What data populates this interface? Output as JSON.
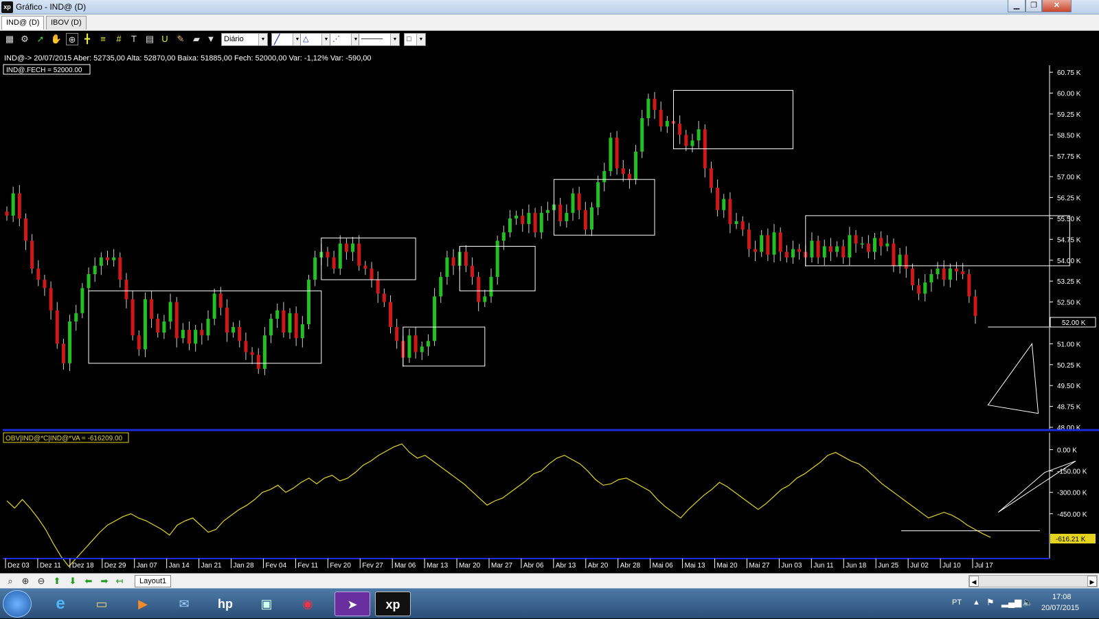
{
  "window": {
    "title": "Gráfico - IND@ (D)",
    "app_icon": "xp",
    "controls": [
      "minimize-icon",
      "restore-icon",
      "close-icon"
    ]
  },
  "tabs": [
    {
      "label": "IND@ (D)",
      "active": true
    },
    {
      "label": "IBOV (D)",
      "active": false
    }
  ],
  "toolbar": {
    "period": "Diário",
    "icons": [
      "chart-type-icon",
      "settings-icon",
      "cursor-icon",
      "hand-icon",
      "zoom-area-icon",
      "crosshair-icon",
      "horizontal-lines-icon",
      "grid-lines-icon",
      "text-tool-icon",
      "calculator-icon",
      "magnet-icon",
      "brush-icon",
      "eraser-icon",
      "filter-icon"
    ]
  },
  "header": {
    "quote_line": "IND@-> 20/07/2015 Aber: 52735,00 Alta: 52870,00 Baixa: 51885,00 Fech: 52000,00 Var: -1,12% Var: -590,00",
    "series_label": "IND@.FECH = 52000.00",
    "price_marker": "52.00 K"
  },
  "indicator": {
    "label": "OBV|IND@*C|IND@*VA = -616209.00",
    "marker": "-616.21 K"
  },
  "chart_data": [
    {
      "type": "candlestick",
      "y_ticks": [
        "48.00 K",
        "48.75 K",
        "49.50 K",
        "50.25 K",
        "51.00 K",
        "51.75 K",
        "52.50 K",
        "53.25 K",
        "54.00 K",
        "54.75 K",
        "55.50 K",
        "56.25 K",
        "57.00 K",
        "57.75 K",
        "58.50 K",
        "59.25 K",
        "60.00 K",
        "60.75 K"
      ],
      "ylim": [
        48000,
        61000
      ],
      "x_labels": [
        "Dez 03",
        "Dez 11",
        "Dez 18",
        "Dez 29",
        "Jan 07",
        "Jan 14",
        "Jan 21",
        "Jan 28",
        "Fev 04",
        "Fev 11",
        "Fev 20",
        "Fev 27",
        "Mar 06",
        "Mar 13",
        "Mar 20",
        "Mar 27",
        "Abr 06",
        "Abr 13",
        "Abr 20",
        "Abr 28",
        "Mai 06",
        "Mai 13",
        "Mai 20",
        "Mai 27",
        "Jun 03",
        "Jun 11",
        "Jun 18",
        "Jun 25",
        "Jul 02",
        "Jul 10",
        "Jul 17"
      ],
      "close": [
        55600,
        56400,
        55500,
        54700,
        53700,
        53300,
        53000,
        52200,
        51000,
        50300,
        51800,
        52100,
        53000,
        53500,
        53800,
        54100,
        54000,
        54100,
        53300,
        52600,
        51300,
        50800,
        52600,
        51900,
        51400,
        51800,
        52500,
        51200,
        51500,
        51000,
        51500,
        51300,
        51900,
        52800,
        52300,
        51400,
        51600,
        51100,
        50700,
        50600,
        50100,
        51300,
        51900,
        52200,
        51400,
        52100,
        51200,
        51700,
        53300,
        54100,
        54300,
        54100,
        53700,
        54600,
        54300,
        54600,
        53800,
        53700,
        53300,
        52800,
        52500,
        51600,
        51100,
        50500,
        51300,
        50700,
        50900,
        51100,
        52700,
        53400,
        54100,
        53800,
        54300,
        53800,
        53400,
        52500,
        52700,
        53400,
        54700,
        55000,
        55500,
        55600,
        55300,
        55700,
        55000,
        55700,
        55800,
        56000,
        55400,
        55700,
        56400,
        55800,
        55100,
        55900,
        56800,
        57200,
        58400,
        57300,
        57100,
        56900,
        57900,
        59100,
        59800,
        59400,
        58800,
        59000,
        58900,
        58500,
        58100,
        58300,
        58700,
        57300,
        56600,
        55800,
        56200,
        55300,
        55400,
        55100,
        54400,
        54300,
        54900,
        54200,
        55000,
        54300,
        54100,
        54400,
        54300,
        54100,
        54700,
        54100,
        54500,
        54300,
        54500,
        54100,
        54900,
        54600,
        54600,
        54300,
        54800,
        54500,
        54600,
        53800,
        54200,
        53700,
        53100,
        52800,
        53200,
        53500,
        53700,
        53300,
        53700,
        53600,
        53500,
        52700,
        52000
      ],
      "boxes": [
        {
          "x0": 13,
          "x1": 50,
          "y0": 50300,
          "y1": 52900
        },
        {
          "x0": 50,
          "x1": 65,
          "y0": 53300,
          "y1": 54800
        },
        {
          "x0": 63,
          "x1": 76,
          "y0": 50200,
          "y1": 51600
        },
        {
          "x0": 72,
          "x1": 84,
          "y0": 52900,
          "y1": 54500
        },
        {
          "x0": 87,
          "x1": 103,
          "y0": 54900,
          "y1": 56900
        },
        {
          "x0": 106,
          "x1": 125,
          "y0": 58000,
          "y1": 60100
        },
        {
          "x0": 127,
          "x1": 169,
          "y0": 53800,
          "y1": 55600
        }
      ],
      "support_line": {
        "x0": 156,
        "x1": 186,
        "y": 51600
      },
      "triangle": [
        [
          156,
          48800
        ],
        [
          163,
          51000
        ],
        [
          164,
          48500
        ]
      ]
    },
    {
      "type": "line",
      "series": [
        {
          "name": "OBV|IND@*C|IND@*VA",
          "values": [
            -360,
            -410,
            -350,
            -410,
            -480,
            -560,
            -660,
            -750,
            -820,
            -760,
            -700,
            -640,
            -580,
            -530,
            -500,
            -470,
            -450,
            -480,
            -500,
            -530,
            -560,
            -600,
            -530,
            -500,
            -480,
            -530,
            -580,
            -560,
            -500,
            -460,
            -420,
            -390,
            -350,
            -300,
            -280,
            -250,
            -300,
            -270,
            -230,
            -200,
            -240,
            -200,
            -180,
            -220,
            -200,
            -160,
            -110,
            -80,
            -40,
            -10,
            20,
            40,
            -20,
            -60,
            -40,
            -80,
            -120,
            -160,
            -200,
            -240,
            -290,
            -340,
            -390,
            -360,
            -340,
            -300,
            -260,
            -220,
            -170,
            -150,
            -100,
            -60,
            -40,
            -70,
            -100,
            -150,
            -210,
            -250,
            -240,
            -210,
            -200,
            -230,
            -260,
            -290,
            -350,
            -400,
            -440,
            -480,
            -420,
            -370,
            -320,
            -280,
            -230,
            -260,
            -300,
            -340,
            -380,
            -420,
            -380,
            -330,
            -280,
            -250,
            -200,
            -170,
            -130,
            -90,
            -40,
            -20,
            -50,
            -80,
            -100,
            -140,
            -190,
            -240,
            -280,
            -320,
            -360,
            -400,
            -440,
            -480,
            -460,
            -440,
            -460,
            -490,
            -530,
            -560,
            -590,
            -616
          ]
        }
      ],
      "y_ticks": [
        "0.00 K",
        "-150.00 K",
        "-300.00 K",
        "-450.00 K"
      ],
      "ylim": [
        -750,
        60
      ],
      "support_line": {
        "y": -570
      },
      "triangle": [
        [
          128,
          -440
        ],
        [
          134,
          -160
        ],
        [
          138,
          -80
        ]
      ]
    }
  ],
  "bottombar": {
    "layout_tab": "Layout1",
    "icons": [
      "zoom-fit-icon",
      "zoom-in-icon",
      "zoom-out-icon",
      "arrow-up-icon",
      "arrow-down-icon",
      "arrow-left-icon",
      "arrow-right-icon",
      "arrow-first-icon"
    ]
  },
  "taskbar": {
    "apps": [
      "ie-icon",
      "explorer-icon",
      "media-player-icon",
      "mail-icon",
      "hp-icon",
      "folder-icon",
      "chrome-icon",
      "arrow-app-icon",
      "xp-icon"
    ],
    "language": "PT",
    "time": "17:08",
    "date": "20/07/2015"
  },
  "colors": {
    "up": "#22c022",
    "down": "#d01818",
    "obv": "#e6d51e",
    "frame": "#ffffff",
    "divider": "#1c2be0"
  }
}
